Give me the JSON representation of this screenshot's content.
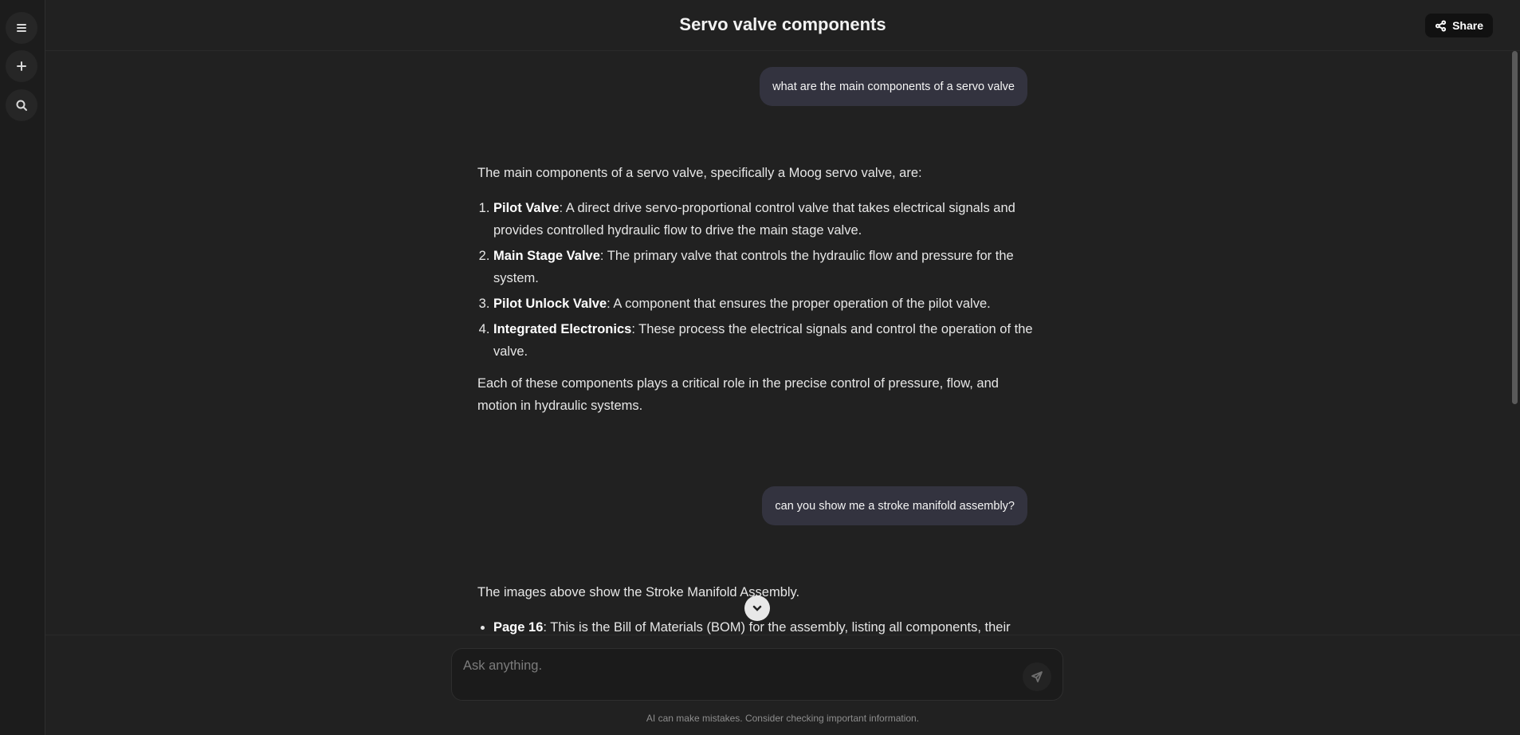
{
  "header": {
    "title": "Servo valve components",
    "share_label": "Share"
  },
  "rail": {
    "icons": [
      "menu-icon",
      "plus-icon",
      "search-icon"
    ]
  },
  "conversation": {
    "user_1": "what are the main components of a servo valve",
    "answer_1": {
      "intro": "The main components of a servo valve, specifically a Moog servo valve, are:",
      "items": [
        {
          "term": "Pilot Valve",
          "desc": ": A direct drive servo-proportional control valve that takes electrical signals and provides controlled hydraulic flow to drive the main stage valve."
        },
        {
          "term": "Main Stage Valve",
          "desc": ": The primary valve that controls the hydraulic flow and pressure for the system."
        },
        {
          "term": "Pilot Unlock Valve",
          "desc": ": A component that ensures the proper operation of the pilot valve."
        },
        {
          "term": "Integrated Electronics",
          "desc": ": These process the electrical signals and control the operation of the valve."
        }
      ],
      "outro": "Each of these components plays a critical role in the precise control of pressure, flow, and motion in hydraulic systems."
    },
    "user_2": "can you show me a stroke manifold assembly?",
    "answer_2": {
      "intro": "The images above show the Stroke Manifold Assembly.",
      "items": [
        {
          "term": "Page 16",
          "desc": ": This is the Bill of Materials (BOM) for the assembly, listing all components, their"
        }
      ]
    }
  },
  "composer": {
    "placeholder": "Ask anything.",
    "disclaimer": "AI can make mistakes. Consider checking important information."
  }
}
